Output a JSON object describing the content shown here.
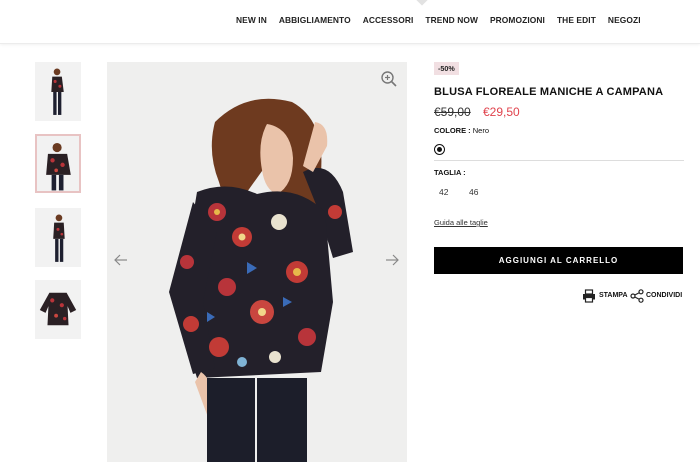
{
  "nav": {
    "items": [
      "NEW IN",
      "ABBIGLIAMENTO",
      "ACCESSORI",
      "TREND NOW",
      "PROMOZIONI",
      "THE EDIT",
      "NEGOZI"
    ]
  },
  "gallery": {
    "thumbnails": [
      "front-standing",
      "front-closeup",
      "side-standing",
      "flat-lay"
    ],
    "active_index": 1
  },
  "product": {
    "badge": "-50%",
    "title": "BLUSA FLOREALE MANICHE A CAMPANA",
    "price_old": "€59,00",
    "price_new": "€29,50",
    "color_label": "COLORE :",
    "color_value": "Nero",
    "size_label": "TAGLIA :",
    "sizes": [
      "42",
      "46"
    ],
    "size_guide": "Guida alle taglie",
    "add_to_cart": "AGGIUNGI AL CARRELLO",
    "print_label": "STAMPA",
    "share_label": "CONDIVIDI"
  },
  "colors": {
    "accent_sale": "#e0434d",
    "badge_bg": "#f1dfe2",
    "active_thumb_border": "#e8c3c3",
    "button_bg": "#000000"
  },
  "icons": {
    "zoom": "zoom-in-icon",
    "prev": "chevron-left-icon",
    "next": "chevron-right-icon",
    "print": "printer-icon",
    "share": "share-icon"
  }
}
